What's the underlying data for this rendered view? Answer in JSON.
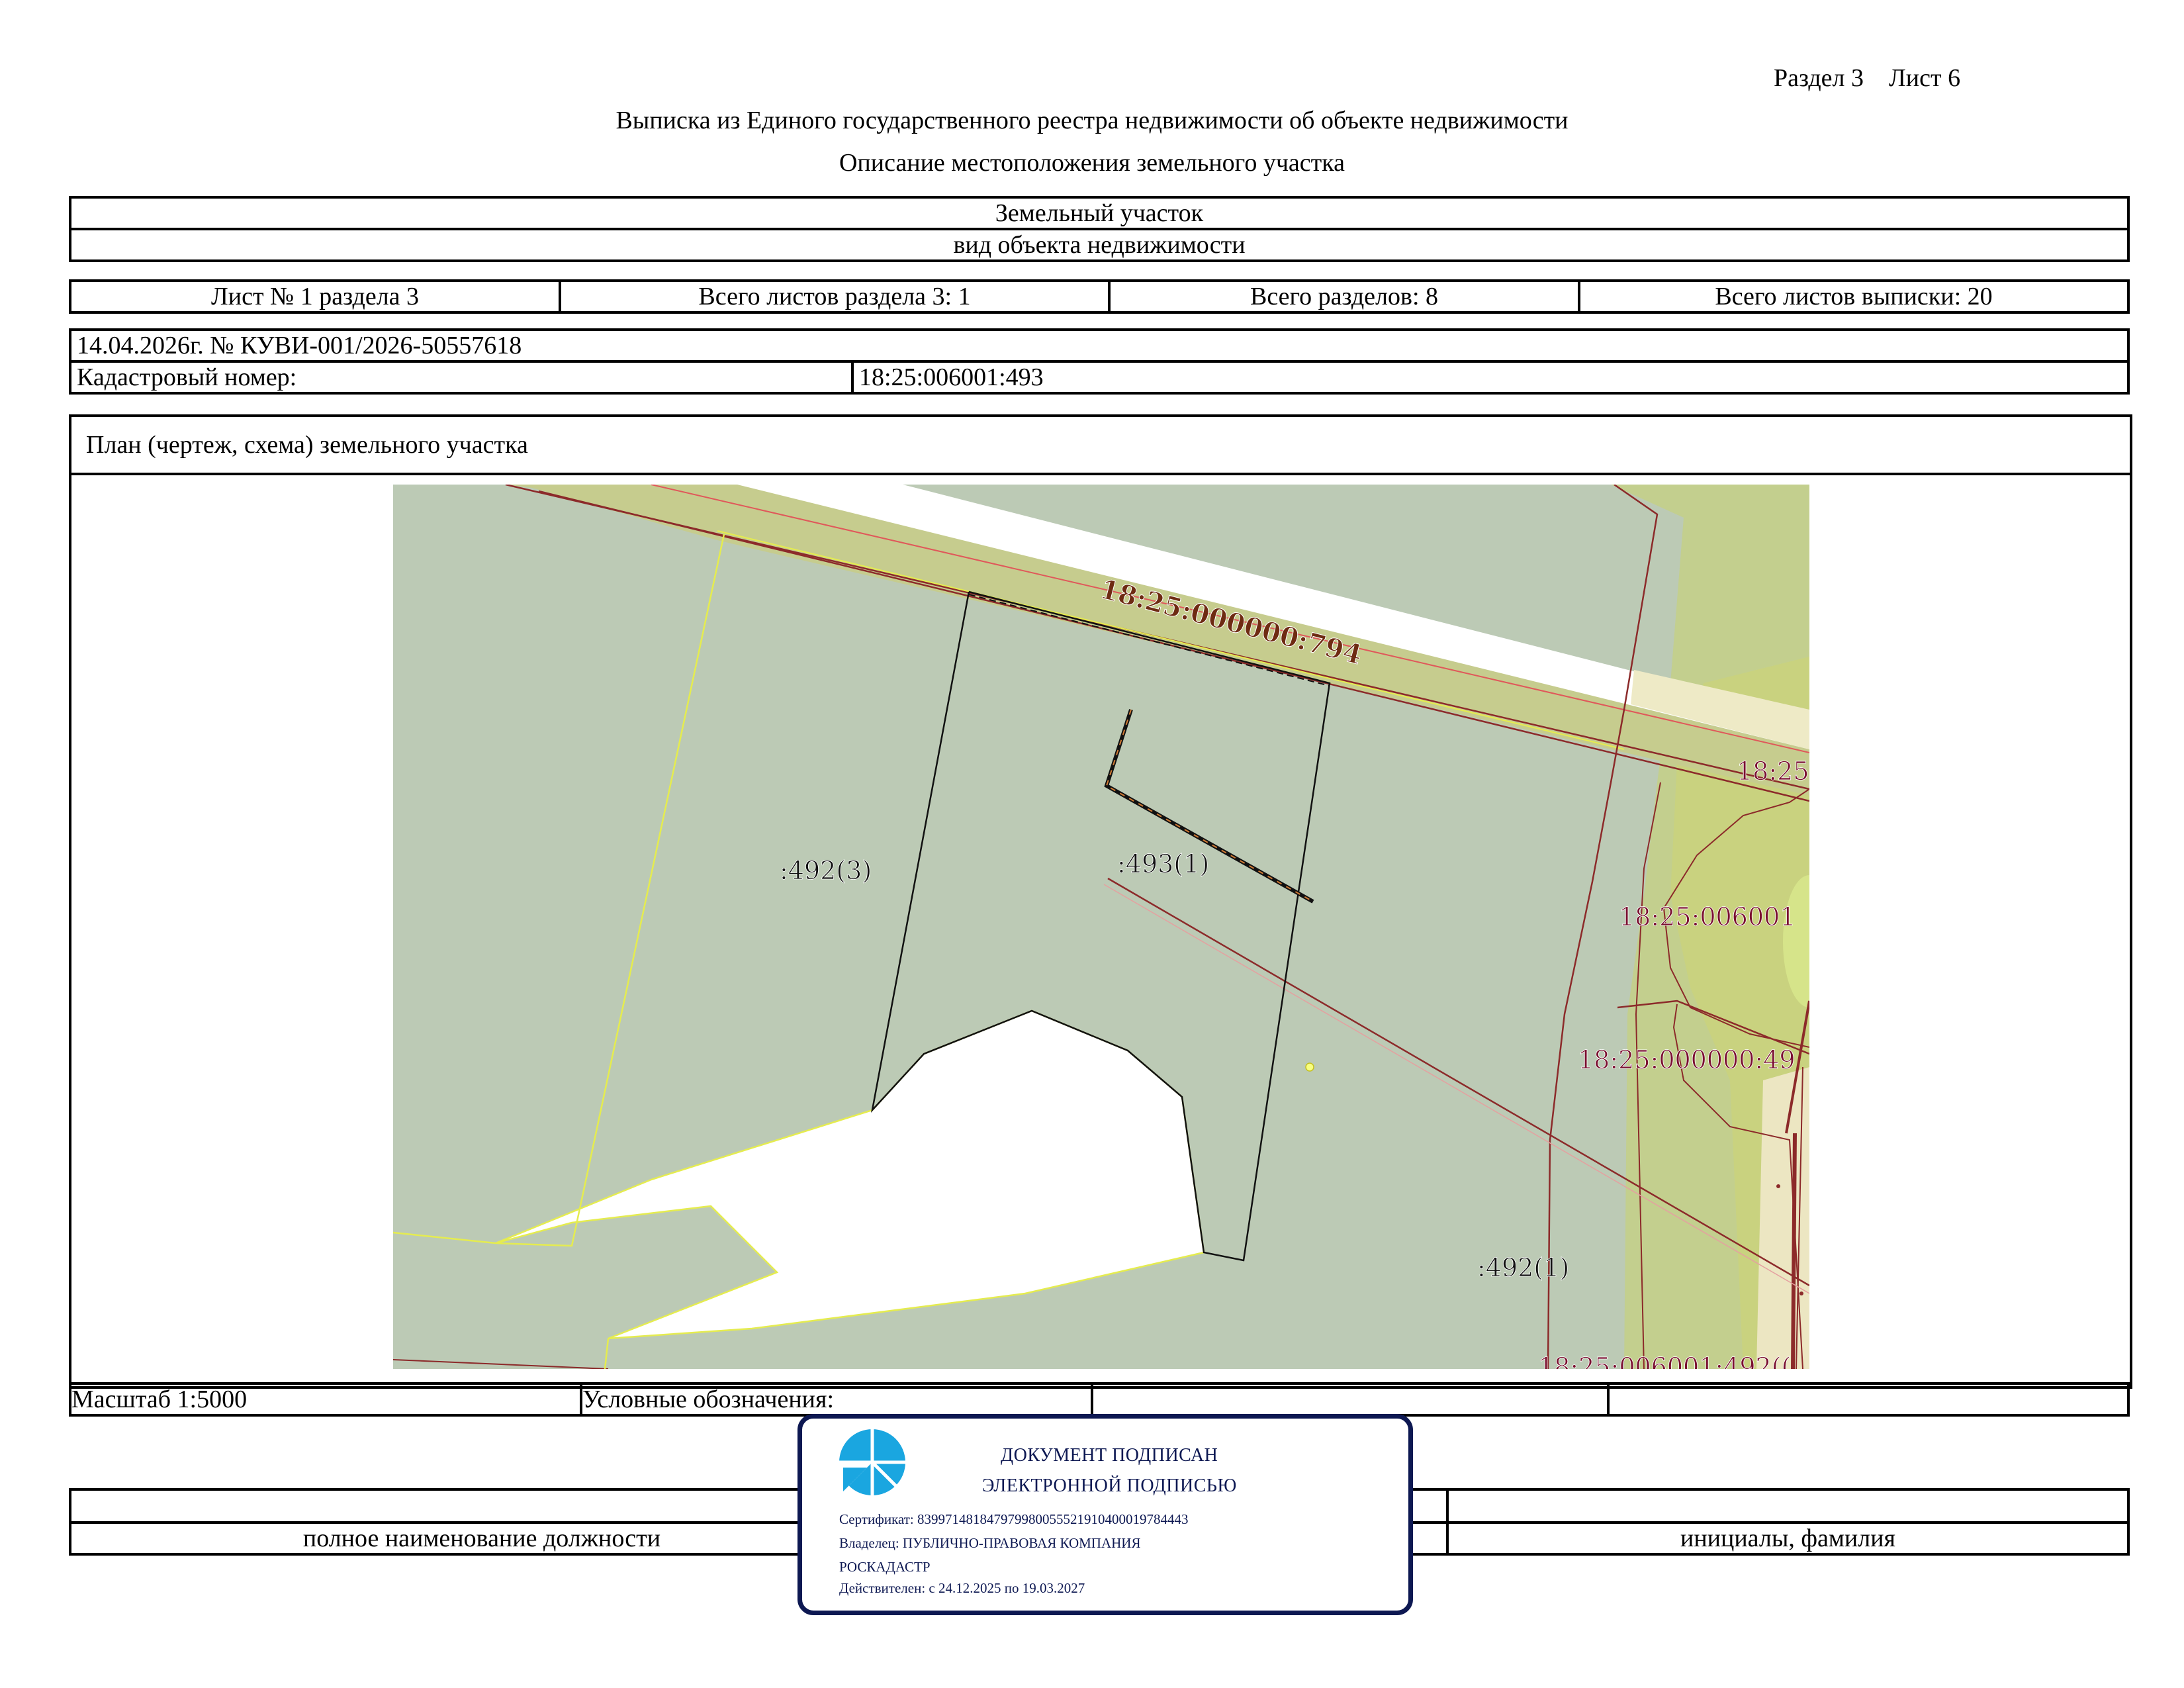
{
  "header": {
    "section": "Раздел 3",
    "sheet": "Лист 6",
    "title": "Выписка из Единого государственного реестра недвижимости об объекте недвижимости",
    "subtitle": "Описание местоположения земельного участка"
  },
  "object": {
    "type": "Земельный участок",
    "type_caption": "вид объекта недвижимости"
  },
  "sheets": {
    "sheet_no": "Лист № 1 раздела 3",
    "section_sheets": "Всего листов раздела 3: 1",
    "sections_total": "Всего разделов: 8",
    "extract_sheets": "Всего листов выписки: 20"
  },
  "record": {
    "date_number": "14.04.2026г. № КУВИ-001/2026-50557618",
    "cadastral_label": "Кадастровый номер:",
    "cadastral_value": "18:25:006001:493"
  },
  "plan": {
    "heading": "План (чертеж, схема) земельного участка",
    "labels": {
      "road": "18:25:000000:794",
      "parcel_492_3": ":492(3)",
      "parcel_493_1": ":493(1)",
      "parcel_492_1": ":492(1)",
      "right_25": "18:25",
      "right_006001": "18:25:006001",
      "right_000000": "18:25:000000:49",
      "bottom_492": "18:25:006001:492(("
    },
    "colors": {
      "parcel_fill": "#bccab5",
      "green_fill": "#c3cf8e",
      "light_green": "#d6e48a",
      "road_strip": "#eeeac6",
      "boundary_brown": "#8c2a2a",
      "boundary_yellow": "#e5ec4f",
      "label_brown": "#6e2b12",
      "label_maroon": "#7a1030"
    }
  },
  "footer": {
    "scale": "Масштаб 1:5000",
    "legend": "Условные обозначения:",
    "position_caption": "полное наименование должности",
    "initials_caption": "инициалы, фамилия"
  },
  "stamp": {
    "line1": "ДОКУМЕНТ ПОДПИСАН",
    "line2": "ЭЛЕКТРОННОЙ ПОДПИСЬЮ",
    "certificate": "Сертификат: 839971481847979980055521910400019784443",
    "owner": "Владелец: ПУБЛИЧНО-ПРАВОВАЯ КОМПАНИЯ",
    "owner2": "РОСКАДАСТР",
    "validity": "Действителен: с 24.12.2025 по 19.03.2027",
    "logo_icon": "roskadastr-logo-icon",
    "color": "#0d1852"
  }
}
